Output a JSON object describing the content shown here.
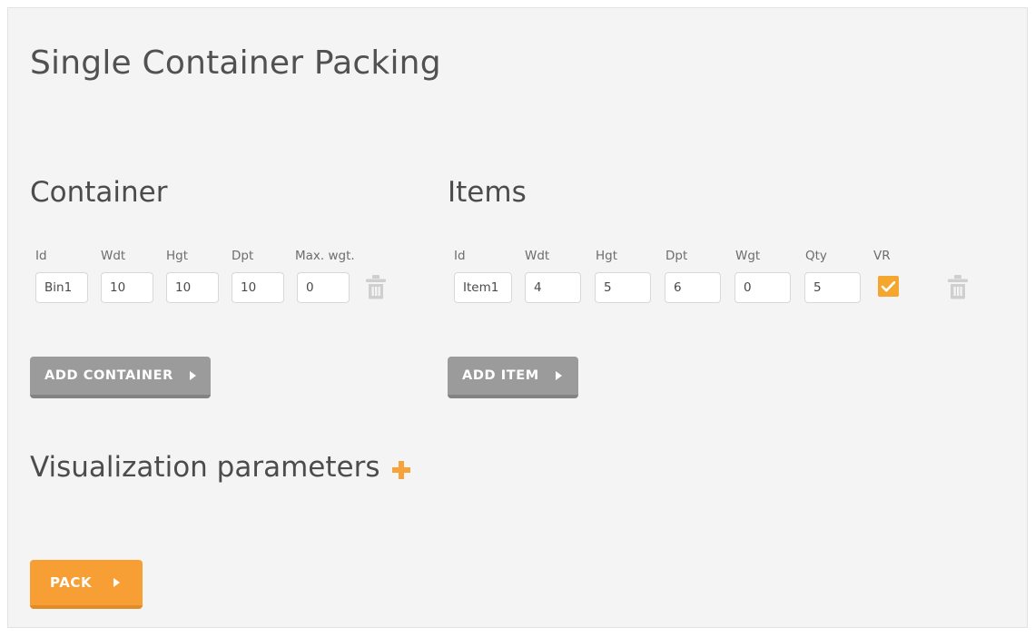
{
  "page": {
    "title": "Single Container Packing"
  },
  "container_section": {
    "heading": "Container",
    "labels": [
      "Id",
      "Wdt",
      "Hgt",
      "Dpt",
      "Max. wgt."
    ],
    "row": {
      "id": "Bin1",
      "wdt": "10",
      "hgt": "10",
      "dpt": "10",
      "max_wgt": "0",
      "delete_icon": "trash-icon"
    },
    "add_button": "ADD CONTAINER"
  },
  "items_section": {
    "heading": "Items",
    "labels": [
      "Id",
      "Wdt",
      "Hgt",
      "Dpt",
      "Wgt",
      "Qty",
      "VR"
    ],
    "row": {
      "id": "Item1",
      "wdt": "4",
      "hgt": "5",
      "dpt": "6",
      "wgt": "0",
      "qty": "5",
      "vr_checked": true,
      "delete_icon": "trash-icon"
    },
    "add_button": "ADD ITEM"
  },
  "visualization": {
    "label": "Visualization parameters",
    "expand_icon": "plus-icon",
    "expanded": false
  },
  "actions": {
    "pack_button": "PACK"
  },
  "colors": {
    "accent_orange": "#f79f34",
    "checkbox_orange": "#f5a62e",
    "plus_orange": "#f5a33a",
    "button_gray": "#9b9b9b",
    "button_gray_shadow": "#838383",
    "panel_background": "#f4f4f4",
    "heading_text": "#4c4c4c",
    "label_text": "#6d6d6d",
    "input_border": "#d8d8d8",
    "trash_gray": "#cfcfcf"
  }
}
